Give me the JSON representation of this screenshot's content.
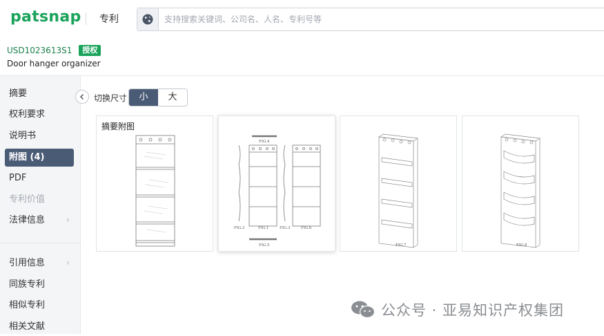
{
  "header": {
    "logo": "patsnap",
    "section": "专利",
    "search_placeholder": "支持搜索关键词、公司名、人名、专利号等"
  },
  "patent": {
    "number": "USD1023613S1",
    "status_badge": "授权",
    "title": "Door hanger organizer"
  },
  "sidebar": {
    "items": [
      {
        "label": "摘要"
      },
      {
        "label": "权利要求"
      },
      {
        "label": "说明书"
      },
      {
        "label": "附图 (4)"
      },
      {
        "label": "PDF"
      },
      {
        "label": "专利价值"
      },
      {
        "label": "法律信息"
      },
      {
        "label": "引用信息"
      },
      {
        "label": "同族专利"
      },
      {
        "label": "相似专利"
      },
      {
        "label": "相关文献"
      }
    ]
  },
  "figures": {
    "size_label": "切换尺寸",
    "size_options": [
      "小",
      "大"
    ],
    "selected_size": "小",
    "cards": [
      {
        "title": "摘要附图"
      },
      {
        "labels": [
          "FIG.4",
          "FIG.2",
          "FIG.1",
          "FIG.3",
          "FIG.6",
          "FIG.5"
        ]
      },
      {
        "labels": [
          "FIG.7"
        ]
      },
      {
        "labels": [
          "FIG.8"
        ]
      }
    ]
  },
  "watermark": {
    "text": "公众号 · 亚易知识产权集团"
  },
  "colors": {
    "brand_green": "#1aa35b",
    "active_nav": "#4a5b75"
  }
}
